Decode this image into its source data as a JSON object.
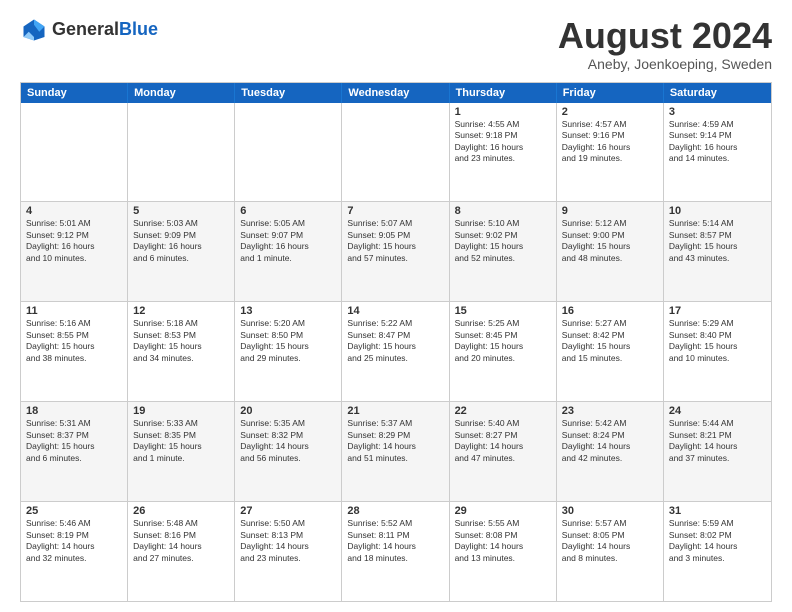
{
  "logo": {
    "general": "General",
    "blue": "Blue"
  },
  "title": "August 2024",
  "location": "Aneby, Joenkoeping, Sweden",
  "header_days": [
    "Sunday",
    "Monday",
    "Tuesday",
    "Wednesday",
    "Thursday",
    "Friday",
    "Saturday"
  ],
  "rows": [
    {
      "alt": false,
      "cells": [
        {
          "day": "",
          "text": ""
        },
        {
          "day": "",
          "text": ""
        },
        {
          "day": "",
          "text": ""
        },
        {
          "day": "",
          "text": ""
        },
        {
          "day": "1",
          "text": "Sunrise: 4:55 AM\nSunset: 9:18 PM\nDaylight: 16 hours\nand 23 minutes."
        },
        {
          "day": "2",
          "text": "Sunrise: 4:57 AM\nSunset: 9:16 PM\nDaylight: 16 hours\nand 19 minutes."
        },
        {
          "day": "3",
          "text": "Sunrise: 4:59 AM\nSunset: 9:14 PM\nDaylight: 16 hours\nand 14 minutes."
        }
      ]
    },
    {
      "alt": true,
      "cells": [
        {
          "day": "4",
          "text": "Sunrise: 5:01 AM\nSunset: 9:12 PM\nDaylight: 16 hours\nand 10 minutes."
        },
        {
          "day": "5",
          "text": "Sunrise: 5:03 AM\nSunset: 9:09 PM\nDaylight: 16 hours\nand 6 minutes."
        },
        {
          "day": "6",
          "text": "Sunrise: 5:05 AM\nSunset: 9:07 PM\nDaylight: 16 hours\nand 1 minute."
        },
        {
          "day": "7",
          "text": "Sunrise: 5:07 AM\nSunset: 9:05 PM\nDaylight: 15 hours\nand 57 minutes."
        },
        {
          "day": "8",
          "text": "Sunrise: 5:10 AM\nSunset: 9:02 PM\nDaylight: 15 hours\nand 52 minutes."
        },
        {
          "day": "9",
          "text": "Sunrise: 5:12 AM\nSunset: 9:00 PM\nDaylight: 15 hours\nand 48 minutes."
        },
        {
          "day": "10",
          "text": "Sunrise: 5:14 AM\nSunset: 8:57 PM\nDaylight: 15 hours\nand 43 minutes."
        }
      ]
    },
    {
      "alt": false,
      "cells": [
        {
          "day": "11",
          "text": "Sunrise: 5:16 AM\nSunset: 8:55 PM\nDaylight: 15 hours\nand 38 minutes."
        },
        {
          "day": "12",
          "text": "Sunrise: 5:18 AM\nSunset: 8:53 PM\nDaylight: 15 hours\nand 34 minutes."
        },
        {
          "day": "13",
          "text": "Sunrise: 5:20 AM\nSunset: 8:50 PM\nDaylight: 15 hours\nand 29 minutes."
        },
        {
          "day": "14",
          "text": "Sunrise: 5:22 AM\nSunset: 8:47 PM\nDaylight: 15 hours\nand 25 minutes."
        },
        {
          "day": "15",
          "text": "Sunrise: 5:25 AM\nSunset: 8:45 PM\nDaylight: 15 hours\nand 20 minutes."
        },
        {
          "day": "16",
          "text": "Sunrise: 5:27 AM\nSunset: 8:42 PM\nDaylight: 15 hours\nand 15 minutes."
        },
        {
          "day": "17",
          "text": "Sunrise: 5:29 AM\nSunset: 8:40 PM\nDaylight: 15 hours\nand 10 minutes."
        }
      ]
    },
    {
      "alt": true,
      "cells": [
        {
          "day": "18",
          "text": "Sunrise: 5:31 AM\nSunset: 8:37 PM\nDaylight: 15 hours\nand 6 minutes."
        },
        {
          "day": "19",
          "text": "Sunrise: 5:33 AM\nSunset: 8:35 PM\nDaylight: 15 hours\nand 1 minute."
        },
        {
          "day": "20",
          "text": "Sunrise: 5:35 AM\nSunset: 8:32 PM\nDaylight: 14 hours\nand 56 minutes."
        },
        {
          "day": "21",
          "text": "Sunrise: 5:37 AM\nSunset: 8:29 PM\nDaylight: 14 hours\nand 51 minutes."
        },
        {
          "day": "22",
          "text": "Sunrise: 5:40 AM\nSunset: 8:27 PM\nDaylight: 14 hours\nand 47 minutes."
        },
        {
          "day": "23",
          "text": "Sunrise: 5:42 AM\nSunset: 8:24 PM\nDaylight: 14 hours\nand 42 minutes."
        },
        {
          "day": "24",
          "text": "Sunrise: 5:44 AM\nSunset: 8:21 PM\nDaylight: 14 hours\nand 37 minutes."
        }
      ]
    },
    {
      "alt": false,
      "cells": [
        {
          "day": "25",
          "text": "Sunrise: 5:46 AM\nSunset: 8:19 PM\nDaylight: 14 hours\nand 32 minutes."
        },
        {
          "day": "26",
          "text": "Sunrise: 5:48 AM\nSunset: 8:16 PM\nDaylight: 14 hours\nand 27 minutes."
        },
        {
          "day": "27",
          "text": "Sunrise: 5:50 AM\nSunset: 8:13 PM\nDaylight: 14 hours\nand 23 minutes."
        },
        {
          "day": "28",
          "text": "Sunrise: 5:52 AM\nSunset: 8:11 PM\nDaylight: 14 hours\nand 18 minutes."
        },
        {
          "day": "29",
          "text": "Sunrise: 5:55 AM\nSunset: 8:08 PM\nDaylight: 14 hours\nand 13 minutes."
        },
        {
          "day": "30",
          "text": "Sunrise: 5:57 AM\nSunset: 8:05 PM\nDaylight: 14 hours\nand 8 minutes."
        },
        {
          "day": "31",
          "text": "Sunrise: 5:59 AM\nSunset: 8:02 PM\nDaylight: 14 hours\nand 3 minutes."
        }
      ]
    }
  ]
}
